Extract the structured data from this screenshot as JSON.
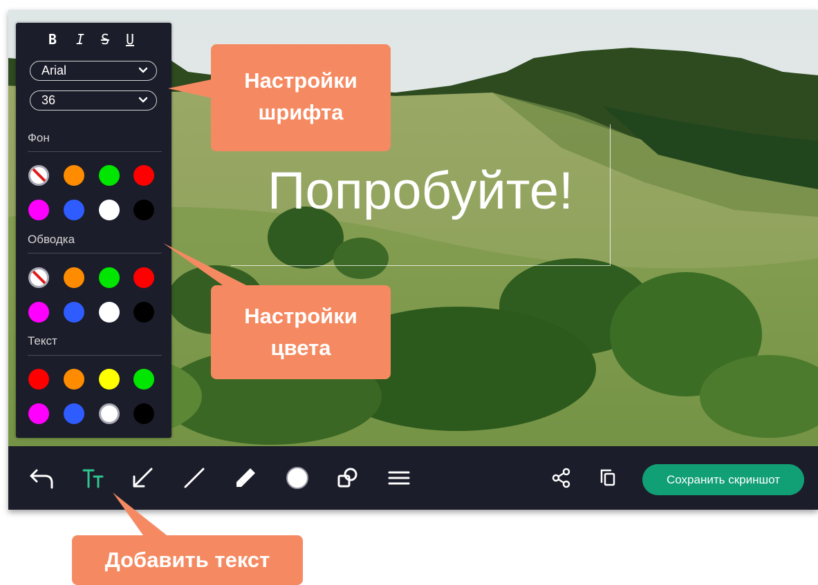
{
  "panel": {
    "format_buttons": [
      "B",
      "I",
      "S",
      "U"
    ],
    "font_family": "Arial",
    "font_size": "36",
    "background_label": "Фон",
    "outline_label": "Обводка",
    "text_label": "Текст",
    "background_colors": [
      "none",
      "#ff8c00",
      "#00e600",
      "#ff0000",
      "#ff00ff",
      "#2f5cff",
      "#ffffff",
      "#000000"
    ],
    "outline_colors": [
      "none",
      "#ff8c00",
      "#00e600",
      "#ff0000",
      "#ff00ff",
      "#2f5cff",
      "#ffffff",
      "#000000"
    ],
    "text_colors": [
      "#ff0000",
      "#ff8c00",
      "#ffff00",
      "#00e600",
      "#ff00ff",
      "#2f5cff",
      "#ffffff",
      "#000000"
    ],
    "text_selected_color": "#ffffff"
  },
  "canvas": {
    "text": "Попробуйте!"
  },
  "toolbar": {
    "tools": [
      "undo-icon",
      "text-tool-icon",
      "arrow-tool-icon",
      "line-tool-icon",
      "marker-tool-icon",
      "color-picker-icon",
      "shapes-tool-icon",
      "menu-icon"
    ],
    "active_tool": "text-tool-icon",
    "active_color": "#2ec68e",
    "save_label": "Сохранить скриншот"
  },
  "callouts": {
    "font_settings": "Настройки шрифта",
    "color_settings": "Настройки цвета",
    "add_text": "Добавить текст"
  },
  "colors": {
    "panel_bg": "#1c1d2a",
    "save_button": "#119f76",
    "callout": "#f58a62"
  }
}
